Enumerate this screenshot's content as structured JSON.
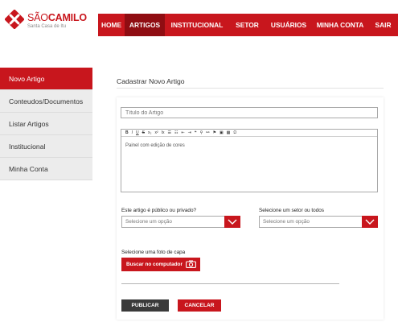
{
  "brand": {
    "name_part1": "SÃO",
    "name_part2": "CAMILO",
    "subtitle": "Santa Casa de Itu",
    "color": "#c8161d"
  },
  "nav": {
    "items": [
      {
        "label": "HOME",
        "active": false
      },
      {
        "label": "ARTIGOS",
        "active": true
      },
      {
        "label": "INSTITUCIONAL",
        "active": false
      },
      {
        "label": "SETOR",
        "active": false
      },
      {
        "label": "USUÁRIOS",
        "active": false
      },
      {
        "label": "MINHA CONTA",
        "active": false
      },
      {
        "label": "SAIR",
        "active": false
      }
    ]
  },
  "sidebar": {
    "items": [
      {
        "label": "Novo Artigo",
        "active": true
      },
      {
        "label": "Conteudos/Documentos",
        "active": false
      },
      {
        "label": "Listar Artigos",
        "active": false
      },
      {
        "label": "Institucional",
        "active": false
      },
      {
        "label": "Minha Conta",
        "active": false
      }
    ]
  },
  "main": {
    "title": "Cadastrar Novo Artigo",
    "title_field": {
      "placeholder": "Título do Artigo",
      "value": ""
    },
    "editor": {
      "toolbar": [
        "B",
        "I",
        "U",
        "S",
        "x₂",
        "x²",
        "Ix",
        "☰",
        "☷",
        "⇤",
        "⇥",
        "❝",
        "⚲",
        "⚯",
        "⚑",
        "▣",
        "▦",
        "Ω"
      ],
      "content": "Painel com edição de cores"
    },
    "visibility": {
      "label": "Este artigo é público ou privado?",
      "selected": "Selecione um opção"
    },
    "sector": {
      "label": "Selecione um setor ou todos",
      "selected": "Selecione um opção"
    },
    "cover": {
      "label": "Selecione uma foto de capa",
      "button_label": "Buscar no computador"
    },
    "publish_label": "PUBLICAR",
    "cancel_label": "CANCELAR"
  },
  "colors": {
    "accent": "#c8161d",
    "accent_dark": "#8f0d12",
    "sidebar_bg": "#ececec",
    "dark_button": "#3a3a3a"
  }
}
